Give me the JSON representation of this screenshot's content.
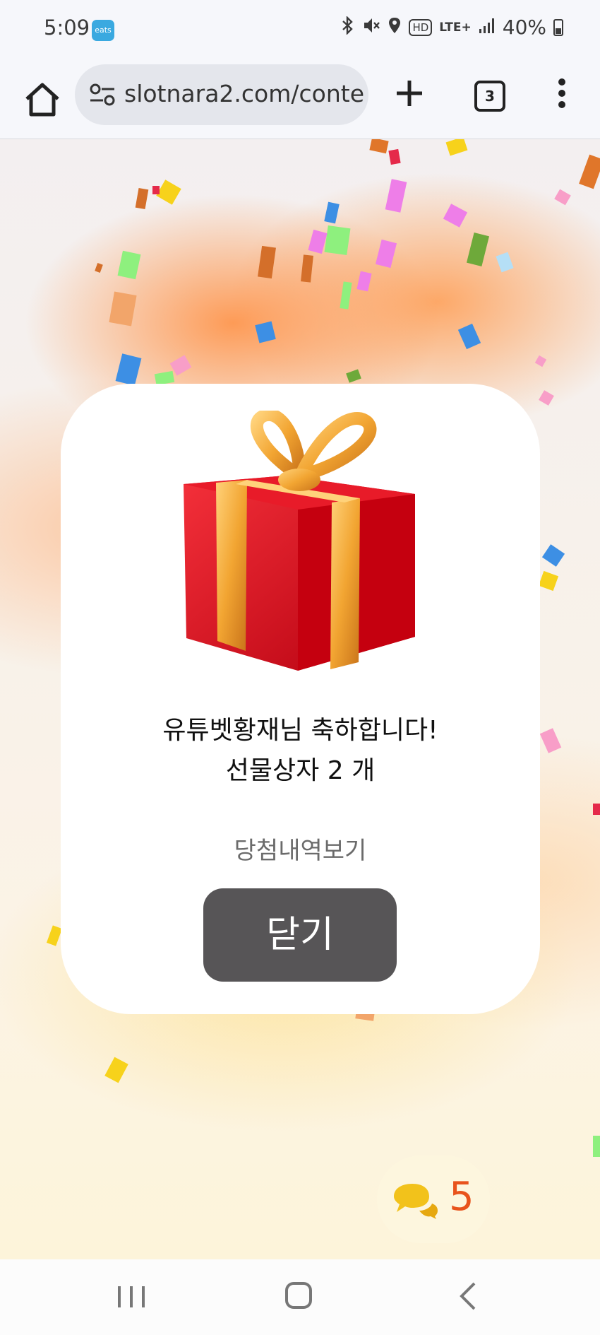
{
  "status_bar": {
    "time": "5:09",
    "app_badge": "eats",
    "hd_label": "HD",
    "network_label": "LTE+",
    "battery_percent": "40%",
    "icons": [
      "bluetooth-icon",
      "mute-icon",
      "location-icon",
      "signal-icon",
      "battery-icon"
    ]
  },
  "browser": {
    "url": "slotnara2.com/conte",
    "tab_count": "3"
  },
  "modal": {
    "congrats_text": "유튜벳황재님 축하합니다!",
    "gift_text": "선물상자 2 개",
    "history_link": "당첨내역보기",
    "close_label": "닫기"
  },
  "chat": {
    "count": "5"
  },
  "colors": {
    "close_button": "#575557",
    "chat_count": "#e8531c",
    "gift_red": "#e0101e",
    "ribbon_gold": "#f2a532"
  }
}
